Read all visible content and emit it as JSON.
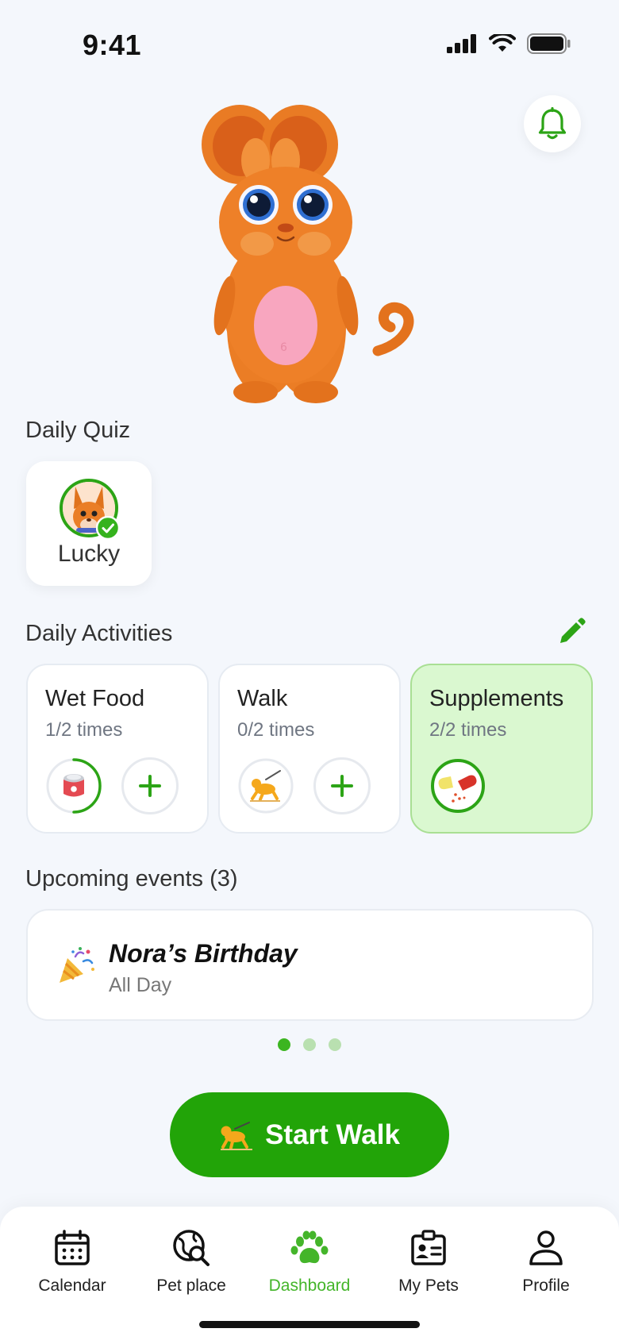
{
  "status_bar": {
    "time": "9:41"
  },
  "daily_quiz": {
    "title": "Daily Quiz",
    "pet_name": "Lucky"
  },
  "daily_activities": {
    "title": "Daily Activities",
    "items": [
      {
        "name": "Wet Food",
        "count": "1/2 times",
        "progress": 0.5,
        "icon": "wet-food-can-icon",
        "completed": false
      },
      {
        "name": "Walk",
        "count": "0/2 times",
        "progress": 0,
        "icon": "walking-dog-icon",
        "completed": false
      },
      {
        "name": "Supplements",
        "count": "2/2 times",
        "progress": 1,
        "icon": "supplement-pill-icon",
        "completed": true
      }
    ]
  },
  "upcoming_events": {
    "title": "Upcoming events (3)",
    "event": {
      "name": "Nora’s Birthday",
      "time": "All Day",
      "icon": "party-popper-icon"
    },
    "pagination": {
      "count": 3,
      "active": 0
    }
  },
  "start_walk": {
    "label": "Start Walk"
  },
  "tab_bar": {
    "items": [
      {
        "label": "Calendar",
        "icon": "calendar-icon"
      },
      {
        "label": "Pet place",
        "icon": "globe-search-icon"
      },
      {
        "label": "Dashboard",
        "icon": "paw-icon",
        "active": true
      },
      {
        "label": "My Pets",
        "icon": "pet-id-badge-icon"
      },
      {
        "label": "Profile",
        "icon": "person-icon"
      }
    ]
  },
  "colors": {
    "accent": "#22a408",
    "accent_light": "#daf8d0",
    "background": "#f4f7fc"
  }
}
